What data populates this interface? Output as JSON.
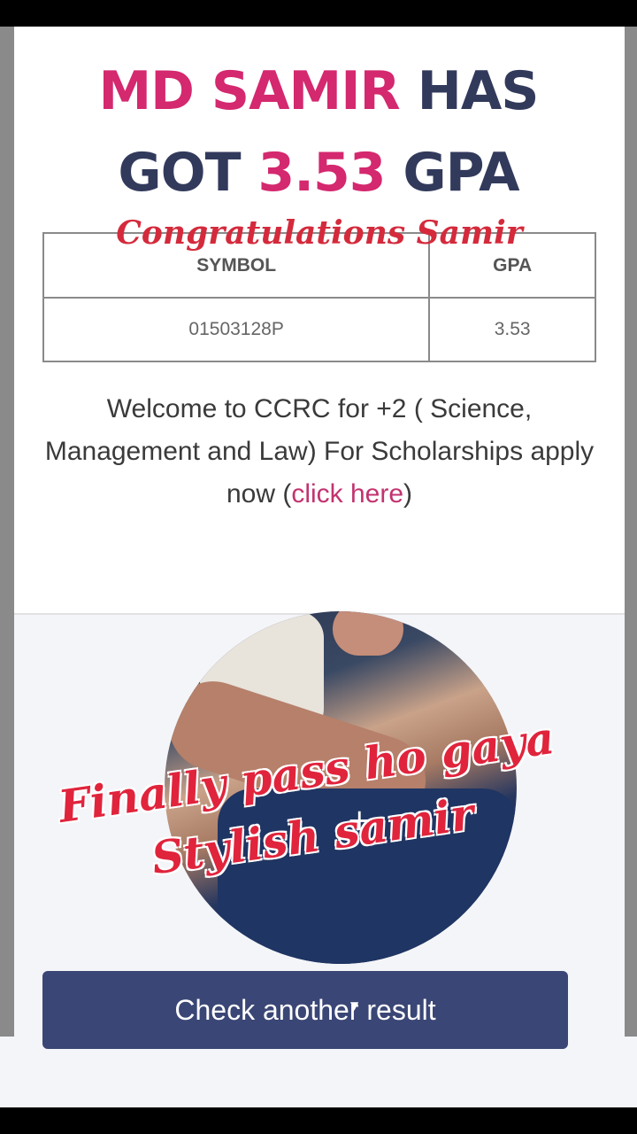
{
  "headline": {
    "line1_name": "MD SAMIR",
    "line1_rest": "HAS",
    "line2_pre": "GOT",
    "line2_gpa": "3.53",
    "line2_post": "GPA"
  },
  "congrats_text": "Congratulations Samir",
  "result_table": {
    "headers": [
      "SYMBOL",
      "GPA"
    ],
    "rows": [
      [
        "01503128P",
        "3.53"
      ]
    ]
  },
  "welcome": {
    "text": "Welcome to CCRC for +2 ( Science, Management and Law) For Scholarships apply now (",
    "link": "click here",
    "suffix": ")"
  },
  "overlay": {
    "line1": "Finally pass ho gaya",
    "line2": "Stylish samir"
  },
  "button": {
    "label": "Check another result"
  },
  "colors": {
    "navy": "#323a5c",
    "pink": "#d4286f",
    "red": "#d42a3c",
    "button_bg": "#3a4675"
  }
}
